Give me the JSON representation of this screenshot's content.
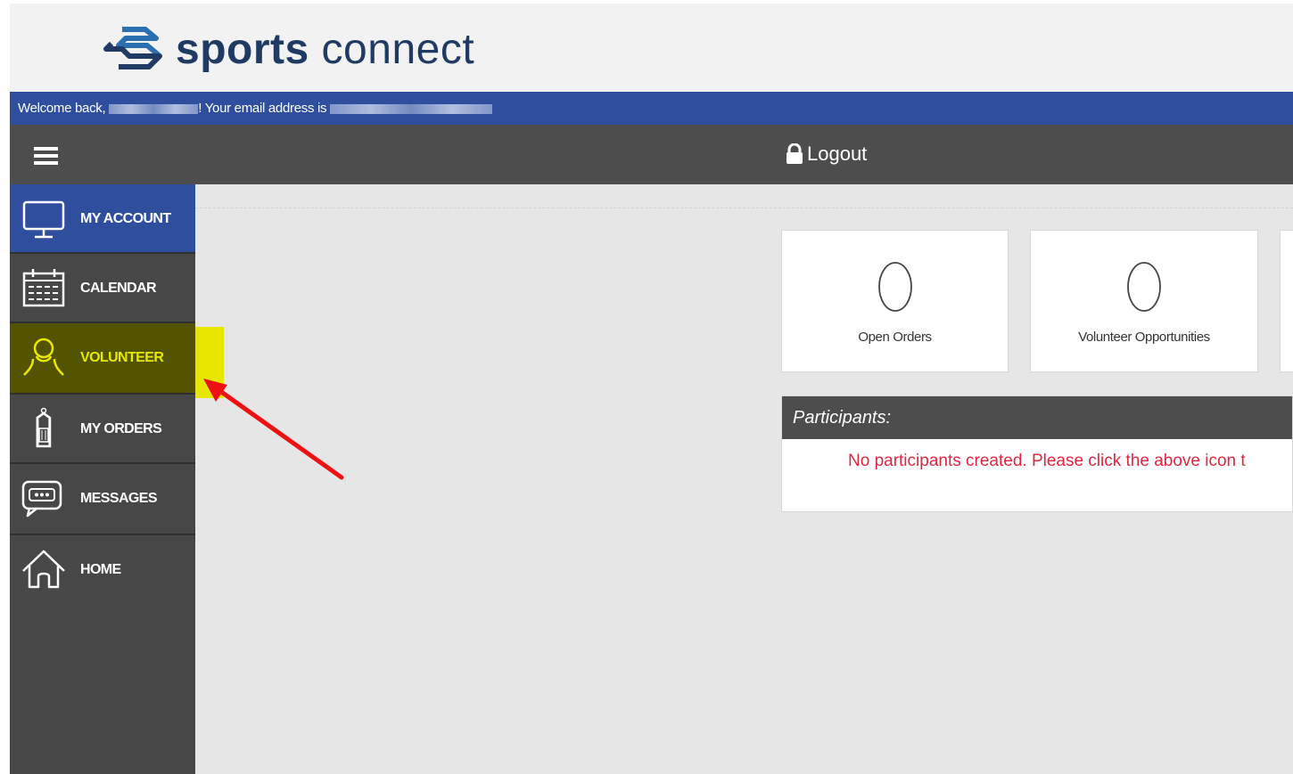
{
  "brand": {
    "name_bold": "sports",
    "name_light": "connect"
  },
  "welcome": {
    "prefix": "Welcome back, ",
    "middle": "! Your email address is "
  },
  "topbar": {
    "logout_label": "Logout"
  },
  "sidebar": {
    "items": [
      {
        "label": "MY ACCOUNT",
        "icon": "monitor-icon",
        "state": "active"
      },
      {
        "label": "CALENDAR",
        "icon": "calendar-icon",
        "state": "normal"
      },
      {
        "label": "VOLUNTEER",
        "icon": "person-icon",
        "state": "highlighted"
      },
      {
        "label": "MY ORDERS",
        "icon": "order-tag-icon",
        "state": "normal"
      },
      {
        "label": "MESSAGES",
        "icon": "chat-bubble-icon",
        "state": "normal"
      },
      {
        "label": "HOME",
        "icon": "house-icon",
        "state": "normal"
      }
    ]
  },
  "cards": [
    {
      "count": "0",
      "label": "Open Orders"
    },
    {
      "count": "0",
      "label": "Volunteer Opportunities"
    }
  ],
  "participants": {
    "title": "Participants:",
    "message": "No participants created. Please click the above icon t"
  },
  "colors": {
    "accent_blue": "#2f4f9e",
    "dark_bar": "#4d4d4d",
    "sidebar": "#474747",
    "highlight_yellow": "#e6e600",
    "annotation_red": "#ee1111",
    "error_red": "#e0263f"
  }
}
